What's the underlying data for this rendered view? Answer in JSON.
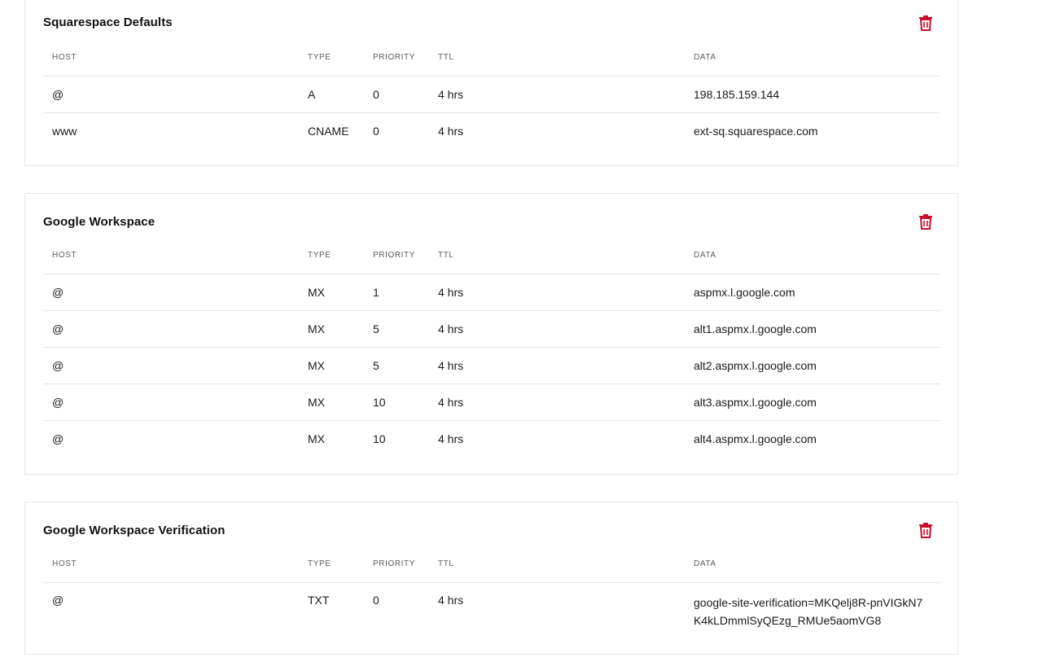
{
  "columns": {
    "host": "HOST",
    "type": "TYPE",
    "priority": "PRIORITY",
    "ttl": "TTL",
    "data": "DATA"
  },
  "icons": {
    "delete": "trash-icon",
    "delete_color": "#c8102e"
  },
  "groups": [
    {
      "title": "Squarespace Defaults",
      "records": [
        {
          "host": "@",
          "type": "A",
          "priority": "0",
          "ttl": "4 hrs",
          "data": "198.185.159.144"
        },
        {
          "host": "www",
          "type": "CNAME",
          "priority": "0",
          "ttl": "4 hrs",
          "data": "ext-sq.squarespace.com"
        }
      ]
    },
    {
      "title": "Google Workspace",
      "records": [
        {
          "host": "@",
          "type": "MX",
          "priority": "1",
          "ttl": "4 hrs",
          "data": "aspmx.l.google.com"
        },
        {
          "host": "@",
          "type": "MX",
          "priority": "5",
          "ttl": "4 hrs",
          "data": "alt1.aspmx.l.google.com"
        },
        {
          "host": "@",
          "type": "MX",
          "priority": "5",
          "ttl": "4 hrs",
          "data": "alt2.aspmx.l.google.com"
        },
        {
          "host": "@",
          "type": "MX",
          "priority": "10",
          "ttl": "4 hrs",
          "data": "alt3.aspmx.l.google.com"
        },
        {
          "host": "@",
          "type": "MX",
          "priority": "10",
          "ttl": "4 hrs",
          "data": "alt4.aspmx.l.google.com"
        }
      ]
    },
    {
      "title": "Google Workspace Verification",
      "records": [
        {
          "host": "@",
          "type": "TXT",
          "priority": "0",
          "ttl": "4 hrs",
          "data": "google-site-verification=MKQelj8R-pnVIGkN7K4kLDmmlSyQEzg_RMUe5aomVG8"
        }
      ]
    }
  ]
}
